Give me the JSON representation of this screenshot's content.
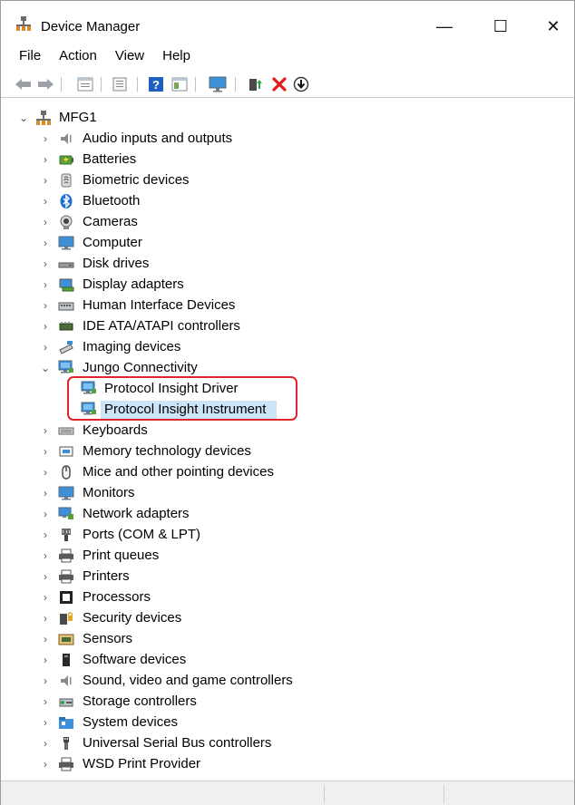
{
  "window": {
    "title": "Device Manager",
    "minimize_glyph": "—",
    "maximize_glyph": "☐",
    "close_glyph": "✕"
  },
  "menu": {
    "items": [
      "File",
      "Action",
      "View",
      "Help"
    ]
  },
  "toolbar": {
    "buttons": [
      "back-arrow-icon",
      "forward-arrow-icon",
      "properties-icon",
      "console-tree-icon",
      "help-icon",
      "view-icon",
      "monitor-icon",
      "update-driver-icon",
      "uninstall-device-icon",
      "scan-hardware-icon"
    ]
  },
  "tree": {
    "root": "MFG1",
    "categories": [
      {
        "label": "Audio inputs and outputs",
        "icon": "speaker-icon"
      },
      {
        "label": "Batteries",
        "icon": "battery-icon"
      },
      {
        "label": "Biometric devices",
        "icon": "fingerprint-icon"
      },
      {
        "label": "Bluetooth",
        "icon": "bluetooth-icon"
      },
      {
        "label": "Cameras",
        "icon": "camera-icon"
      },
      {
        "label": "Computer",
        "icon": "computer-icon"
      },
      {
        "label": "Disk drives",
        "icon": "disk-drive-icon"
      },
      {
        "label": "Display adapters",
        "icon": "display-adapter-icon"
      },
      {
        "label": "Human Interface Devices",
        "icon": "hid-icon"
      },
      {
        "label": "IDE ATA/ATAPI controllers",
        "icon": "ide-controller-icon"
      },
      {
        "label": "Imaging devices",
        "icon": "imaging-icon"
      },
      {
        "label": "Jungo Connectivity",
        "icon": "network-monitor-icon",
        "expanded": true,
        "children": [
          {
            "label": "Protocol Insight Driver",
            "icon": "network-monitor-icon"
          },
          {
            "label": "Protocol Insight Instrument",
            "icon": "network-monitor-icon",
            "selected": true
          }
        ]
      },
      {
        "label": "Keyboards",
        "icon": "keyboard-icon"
      },
      {
        "label": "Memory technology devices",
        "icon": "memory-icon"
      },
      {
        "label": "Mice and other pointing devices",
        "icon": "mouse-icon"
      },
      {
        "label": "Monitors",
        "icon": "monitor-icon"
      },
      {
        "label": "Network adapters",
        "icon": "network-adapter-icon"
      },
      {
        "label": "Ports (COM & LPT)",
        "icon": "port-icon"
      },
      {
        "label": "Print queues",
        "icon": "printer-icon"
      },
      {
        "label": "Printers",
        "icon": "printer-icon"
      },
      {
        "label": "Processors",
        "icon": "processor-icon"
      },
      {
        "label": "Security devices",
        "icon": "security-icon"
      },
      {
        "label": "Sensors",
        "icon": "sensor-icon"
      },
      {
        "label": "Software devices",
        "icon": "software-device-icon"
      },
      {
        "label": "Sound, video and game controllers",
        "icon": "speaker-icon"
      },
      {
        "label": "Storage controllers",
        "icon": "storage-icon"
      },
      {
        "label": "System devices",
        "icon": "system-folder-icon"
      },
      {
        "label": "Universal Serial Bus controllers",
        "icon": "usb-icon"
      },
      {
        "label": "WSD Print Provider",
        "icon": "printer-icon"
      }
    ]
  },
  "colors": {
    "selection": "#cce4f7",
    "highlight_border": "#e0242b",
    "uninstall_red": "#e21b1b",
    "help_blue": "#1f5fbf"
  }
}
